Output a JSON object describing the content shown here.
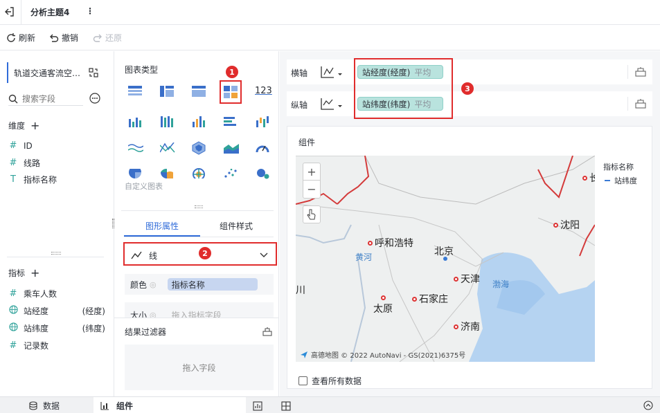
{
  "topbar": {
    "tab_title": "分析主题4",
    "more": "⋮"
  },
  "toolbar": {
    "refresh": "刷新",
    "undo": "撤销",
    "redo": "还原"
  },
  "left": {
    "dataset": "轨道交通客流空…",
    "search_placeholder": "搜索字段",
    "dimensions_title": "维度",
    "dimensions": [
      {
        "icon": "#",
        "label": "ID"
      },
      {
        "icon": "#",
        "label": "线路"
      },
      {
        "icon": "T",
        "label": "指标名称"
      }
    ],
    "measures_title": "指标",
    "measures": [
      {
        "icon": "#",
        "label": "乘车人数",
        "suffix": ""
      },
      {
        "icon": "globe",
        "label": "站经度",
        "suffix": "(经度)"
      },
      {
        "icon": "globe",
        "label": "站纬度",
        "suffix": "(纬度)"
      },
      {
        "icon": "#",
        "label": "记录数",
        "suffix": ""
      }
    ]
  },
  "middle": {
    "chart_types_title": "图表类型",
    "custom_chart": "自定义图表",
    "number_icon_text": "123",
    "tabs": [
      "图形属性",
      "组件样式"
    ],
    "mark_type": "线",
    "color_label": "颜色",
    "color_field": "指标名称",
    "size_label": "大小",
    "size_placeholder": "拖入指标字段",
    "filter_title": "结果过滤器",
    "filter_placeholder": "拖入字段"
  },
  "axes": {
    "x_label": "横轴",
    "x_field": "站经度(经度)",
    "x_agg": "平均",
    "y_label": "纵轴",
    "y_field": "站纬度(纬度)",
    "y_agg": "平均"
  },
  "component": {
    "title": "组件",
    "legend_title": "指标名称",
    "legend_item": "站纬度",
    "zoom_in": "+",
    "zoom_out": "−",
    "attribution": "高德地图 © 2022 AutoNavi - GS(2021)6375号",
    "view_all": "查看所有数据",
    "cities": [
      "呼和浩特",
      "北京",
      "天津",
      "石家庄",
      "太原",
      "济南",
      "沈阳"
    ],
    "water": [
      "黄河",
      "渤海"
    ],
    "partial_label": "银川",
    "partial_right": "长"
  },
  "statusbar": {
    "data_tab": "数据",
    "component_tab": "组件"
  },
  "badges": [
    "1",
    "2",
    "3"
  ],
  "colors": {
    "accent": "#2f6bd9",
    "highlight": "#e02c2c",
    "pill": "#b9e3de",
    "teal": "#2fa29a"
  }
}
